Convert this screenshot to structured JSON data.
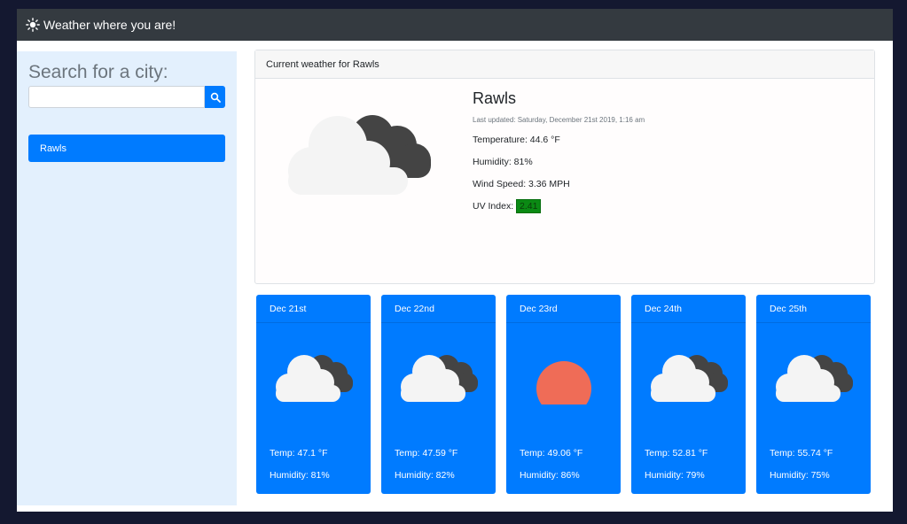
{
  "navbar": {
    "brand": "Weather where you are!",
    "icon": "sun-icon"
  },
  "sidebar": {
    "heading": "Search for a city:",
    "search": {
      "value": "",
      "placeholder": "",
      "button_icon": "search-icon"
    },
    "cities": [
      "Rawls"
    ]
  },
  "current": {
    "header": "Current weather for Rawls",
    "city": "Rawls",
    "updated": "Last updated: Saturday, December 21st 2019, 1:16 am",
    "temperature": "Temperature: 44.6 °F",
    "humidity": "Humidity: 81%",
    "wind": "Wind Speed: 3.36 MPH",
    "uv_label": "UV Index:",
    "uv_value": "2.41",
    "uv_color": "#0b8a14",
    "icon": "cloudy-icon"
  },
  "forecast": [
    {
      "date": "Dec 21st",
      "temp": "Temp: 47.1 °F",
      "humidity": "Humidity: 81%",
      "icon": "cloudy-icon"
    },
    {
      "date": "Dec 22nd",
      "temp": "Temp: 47.59 °F",
      "humidity": "Humidity: 82%",
      "icon": "cloudy-icon"
    },
    {
      "date": "Dec 23rd",
      "temp": "Temp: 49.06 °F",
      "humidity": "Humidity: 86%",
      "icon": "sun-icon"
    },
    {
      "date": "Dec 24th",
      "temp": "Temp: 52.81 °F",
      "humidity": "Humidity: 79%",
      "icon": "cloudy-icon"
    },
    {
      "date": "Dec 25th",
      "temp": "Temp: 55.74 °F",
      "humidity": "Humidity: 75%",
      "icon": "cloudy-icon"
    }
  ],
  "colors": {
    "accent": "#007bff",
    "navbar": "#343a40",
    "sidebar": "#e3f0fd",
    "sun": "#ef6c57"
  }
}
